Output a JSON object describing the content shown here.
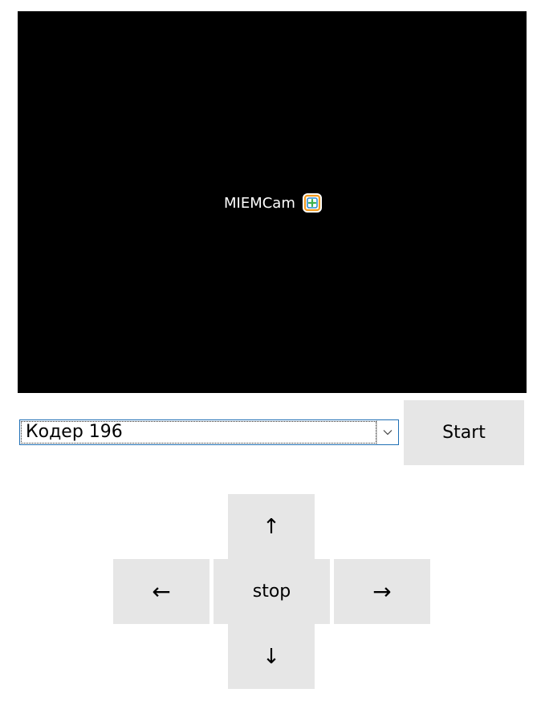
{
  "video": {
    "logo_text": "MIEMCam",
    "logo_icon": "miem-plus-icon",
    "background_color": "#000000"
  },
  "encoder_select": {
    "selected": "Кодер 196",
    "arrow_icon": "chevron-down-icon"
  },
  "buttons": {
    "start": "Start",
    "up": "↑",
    "left": "←",
    "stop": "stop",
    "right": "→",
    "down": "↓"
  },
  "colors": {
    "button_bg": "#e6e6e6",
    "select_border": "#1f6fb5",
    "logo_orange": "#f39a1e",
    "logo_blue": "#2a8fd8",
    "logo_green": "#3fb34f"
  }
}
